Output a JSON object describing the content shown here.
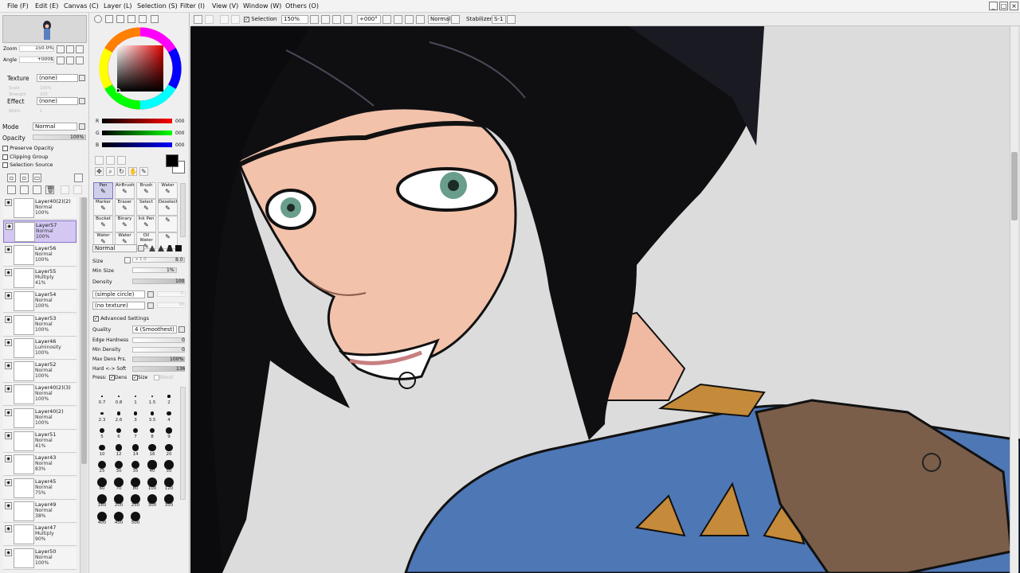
{
  "menubar": {
    "items": [
      "File (F)",
      "Edit (E)",
      "Canvas (C)",
      "Layer (L)",
      "Selection (S)",
      "Filter (I)",
      "View (V)",
      "Window (W)",
      "Others (O)"
    ]
  },
  "toolbar": {
    "selection_label": "Selection",
    "zoom_value": "150%",
    "angle_value": "+000°",
    "blend_value": "Normal",
    "stabilizer_label": "Stabilizer",
    "stabilizer_value": "S-1"
  },
  "navigator": {
    "zoom_label": "Zoom",
    "zoom_value": "150.0%",
    "angle_label": "Angle",
    "angle_value": "+000$"
  },
  "texture": {
    "label": "Texture",
    "value": "(none)",
    "scale_label": "Scale",
    "scale_value": "100%",
    "strength_label": "Strength",
    "strength_value": "100"
  },
  "effect": {
    "label": "Effect",
    "value": "(none)",
    "width_label": "Width",
    "width_value": "1"
  },
  "layer_props": {
    "mode_label": "Mode",
    "mode_value": "Normal",
    "opacity_label": "Opacity",
    "opacity_value": "100%",
    "preserve_opacity": "Preserve Opacity",
    "clipping_group": "Clipping Group",
    "selection_source": "Selection Source"
  },
  "layers": [
    {
      "name": "Layer40(2)(2)",
      "mode": "Normal",
      "opacity": "100%",
      "selected": false
    },
    {
      "name": "Layer57",
      "mode": "Normal",
      "opacity": "100%",
      "selected": true
    },
    {
      "name": "Layer56",
      "mode": "Normal",
      "opacity": "100%",
      "selected": false
    },
    {
      "name": "Layer55",
      "mode": "Multiply",
      "opacity": "41%",
      "selected": false
    },
    {
      "name": "Layer54",
      "mode": "Normal",
      "opacity": "100%",
      "selected": false
    },
    {
      "name": "Layer53",
      "mode": "Normal",
      "opacity": "100%",
      "selected": false
    },
    {
      "name": "Layer46",
      "mode": "Luminosity",
      "opacity": "100%",
      "selected": false
    },
    {
      "name": "Layer52",
      "mode": "Normal",
      "opacity": "100%",
      "selected": false
    },
    {
      "name": "Layer40(2)(3)",
      "mode": "Normal",
      "opacity": "100%",
      "selected": false
    },
    {
      "name": "Layer40(2)",
      "mode": "Normal",
      "opacity": "100%",
      "selected": false
    },
    {
      "name": "Layer51",
      "mode": "Normal",
      "opacity": "41%",
      "selected": false
    },
    {
      "name": "Layer43",
      "mode": "Normal",
      "opacity": "83%",
      "selected": false
    },
    {
      "name": "Layer45",
      "mode": "Normal",
      "opacity": "75%",
      "selected": false
    },
    {
      "name": "Layer49",
      "mode": "Normal",
      "opacity": "38%",
      "selected": false
    },
    {
      "name": "Layer47",
      "mode": "Multiply",
      "opacity": "90%",
      "selected": false
    },
    {
      "name": "Layer50",
      "mode": "Normal",
      "opacity": "100%",
      "selected": false
    }
  ],
  "color": {
    "r_label": "R",
    "g_label": "G",
    "b_label": "B",
    "r_value": "000",
    "g_value": "000",
    "b_value": "000",
    "primary": "#000000",
    "secondary": "#ffffff"
  },
  "tools": [
    {
      "label": "Pen",
      "selected": true
    },
    {
      "label": "AirBrush",
      "selected": false
    },
    {
      "label": "Brush",
      "selected": false
    },
    {
      "label": "Water",
      "selected": false
    },
    {
      "label": "Marker",
      "selected": false
    },
    {
      "label": "Eraser",
      "selected": false
    },
    {
      "label": "Select",
      "selected": false
    },
    {
      "label": "Deselect",
      "selected": false
    },
    {
      "label": "Bucket",
      "selected": false
    },
    {
      "label": "Binary",
      "selected": false
    },
    {
      "label": "Ink Pen",
      "selected": false
    },
    {
      "label": "",
      "selected": false
    },
    {
      "label": "Water",
      "selected": false
    },
    {
      "label": "Water",
      "selected": false
    },
    {
      "label": "Oil Water",
      "selected": false
    },
    {
      "label": "",
      "selected": false
    }
  ],
  "brush": {
    "blend_value": "Normal",
    "size_label": "Size",
    "size_mult": "x 1.0",
    "size_value": "8.0",
    "minsize_label": "Min Size",
    "minsize_value": "1%",
    "density_label": "Density",
    "density_value": "100",
    "shape_value": "(simple circle)",
    "shape_num": "0",
    "texture_value": "(no texture)",
    "texture_num": "95",
    "advanced_label": "Advanced Settings",
    "quality_label": "Quality",
    "quality_value": "4 (Smoothest)",
    "edge_label": "Edge Hardness",
    "edge_value": "0",
    "mindens_label": "Min Density",
    "mindens_value": "0",
    "maxdens_label": "Max Dens Prs.",
    "maxdens_value": "100%",
    "hardsoft_label": "Hard <-> Soft",
    "hardsoft_value": "136",
    "press_label": "Press:",
    "dens_label": "Dens",
    "size_chk_label": "Size",
    "blend_chk_label": "Blend"
  },
  "brush_sizes": [
    "0.7",
    "0.8",
    "1",
    "1.5",
    "2",
    "2.3",
    "2.6",
    "3",
    "3.5",
    "4",
    "5",
    "6",
    "7",
    "8",
    "9",
    "10",
    "12",
    "14",
    "16",
    "20",
    "25",
    "30",
    "35",
    "40",
    "50",
    "60",
    "70",
    "80",
    "100",
    "120",
    "160",
    "200",
    "250",
    "300",
    "350",
    "400",
    "450",
    "500"
  ]
}
